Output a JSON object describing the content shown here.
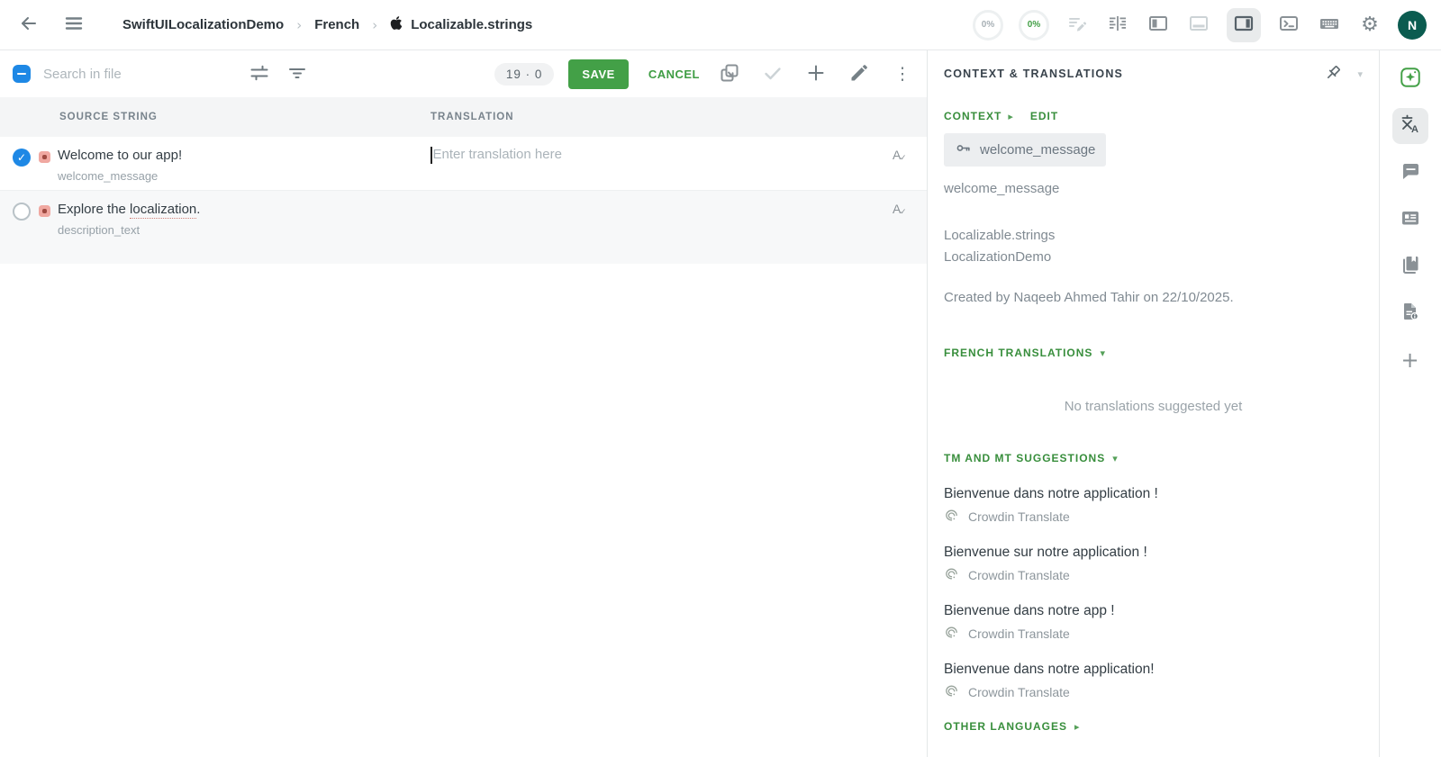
{
  "icons": {
    "kebab": "⋮",
    "gear": "⚙",
    "caret_down": "▾",
    "caret_right": "▸",
    "chevron": "›",
    "check": "✓",
    "a_letter": "A",
    "plus": "+"
  },
  "topbar": {
    "breadcrumb": {
      "project": "SwiftUILocalizationDemo",
      "language": "French",
      "file": "Localizable.strings"
    },
    "progress_source": "0%",
    "progress_translated": "0%",
    "avatar": "N"
  },
  "toolbar": {
    "search_placeholder": "Search in file",
    "counter": "19 · 0",
    "save_label": "SAVE",
    "cancel_label": "CANCEL"
  },
  "table": {
    "headers": {
      "source": "SOURCE STRING",
      "translation": "TRANSLATION"
    },
    "rows": [
      {
        "source": "Welcome to our app!",
        "key": "welcome_message",
        "translation_placeholder": "Enter translation here"
      },
      {
        "source_prefix": "Explore the ",
        "source_underlined": "localization",
        "source_suffix": ".",
        "key": "description_text"
      }
    ]
  },
  "panel": {
    "title": "CONTEXT & TRANSLATIONS",
    "context_label": "CONTEXT",
    "edit_label": "EDIT",
    "key_chip": "welcome_message",
    "key_text": "welcome_message",
    "file_name": "Localizable.strings",
    "project_name": "LocalizationDemo",
    "created_text": "Created by Naqeeb Ahmed Tahir on 22/10/2025.",
    "translations_header": "FRENCH TRANSLATIONS",
    "no_translations": "No translations suggested yet",
    "suggestions_header": "TM AND MT SUGGESTIONS",
    "suggestions": [
      {
        "text": "Bienvenue dans notre application !",
        "source": "Crowdin Translate"
      },
      {
        "text": "Bienvenue sur notre application !",
        "source": "Crowdin Translate"
      },
      {
        "text": "Bienvenue dans notre app !",
        "source": "Crowdin Translate"
      },
      {
        "text": "Bienvenue dans notre application!",
        "source": "Crowdin Translate"
      }
    ],
    "other_languages_header": "OTHER LANGUAGES"
  },
  "colors": {
    "accent_green": "#43a047",
    "header_green": "#388e3c",
    "checkbox_blue": "#1e88e5",
    "status_red": "#f0a8a1",
    "avatar_bg": "#0b5c50"
  }
}
